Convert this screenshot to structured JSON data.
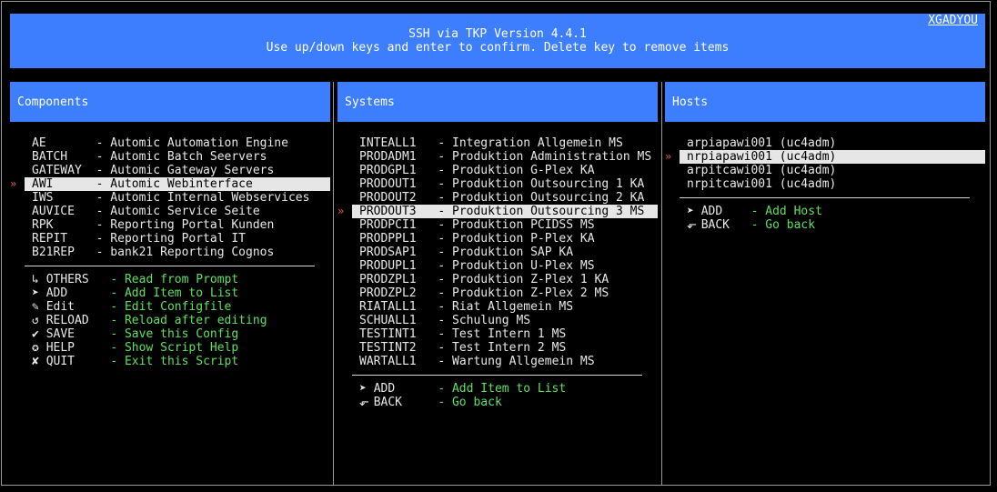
{
  "header": {
    "title": "SSH via TKP Version 4.4.1",
    "hint": "Use up/down keys and enter to confirm. Delete key to remove items",
    "user": "XGADYOU"
  },
  "components": {
    "title": "Components",
    "items": [
      {
        "key": "AE",
        "desc": "Automic Automation Engine"
      },
      {
        "key": "BATCH",
        "desc": "Automic Batch Seervers"
      },
      {
        "key": "GATEWAY",
        "desc": "Automic Gateway Servers"
      },
      {
        "key": "AWI",
        "desc": "Automic Webinterface"
      },
      {
        "key": "IWS",
        "desc": "Automic Internal Webservices"
      },
      {
        "key": "AUVICE",
        "desc": "Automic Service Seite"
      },
      {
        "key": "RPK",
        "desc": "Reporting Portal Kunden"
      },
      {
        "key": "REPIT",
        "desc": "Reporting Portal IT"
      },
      {
        "key": "B21REP",
        "desc": "bank21 Reporting Cognos"
      }
    ],
    "selected_index": 3,
    "actions": [
      {
        "icon": "↳",
        "key": "OTHERS",
        "desc": "Read from Prompt"
      },
      {
        "icon": "➤",
        "key": "ADD",
        "desc": "Add Item to List"
      },
      {
        "icon": "✎",
        "key": "Edit",
        "desc": "Edit Configfile"
      },
      {
        "icon": "↺",
        "key": "RELOAD",
        "desc": "Reload after editing"
      },
      {
        "icon": "✔",
        "key": "SAVE",
        "desc": "Save this Config"
      },
      {
        "icon": "✪",
        "key": "HELP",
        "desc": "Show Script Help"
      },
      {
        "icon": "✘",
        "key": "QUIT",
        "desc": "Exit this Script"
      }
    ]
  },
  "systems": {
    "title": "Systems",
    "items": [
      {
        "key": "INTEALL1",
        "desc": "Integration Allgemein MS"
      },
      {
        "key": "PRODADM1",
        "desc": "Produktion Administration MS"
      },
      {
        "key": "PRODGPL1",
        "desc": "Produktion G-Plex KA"
      },
      {
        "key": "PRODOUT1",
        "desc": "Produktion Outsourcing 1 KA"
      },
      {
        "key": "PRODOUT2",
        "desc": "Produktion Outsourcing 2 KA"
      },
      {
        "key": "PRODOUT3",
        "desc": "Produktion Outsourcing 3 MS"
      },
      {
        "key": "PRODPCI1",
        "desc": "Produktion PCIDSS MS"
      },
      {
        "key": "PRODPPL1",
        "desc": "Produktion P-Plex KA"
      },
      {
        "key": "PRODSAP1",
        "desc": "Produktion SAP KA"
      },
      {
        "key": "PRODUPL1",
        "desc": "Produktion U-Plex MS"
      },
      {
        "key": "PRODZPL1",
        "desc": "Produktion Z-Plex 1 KA"
      },
      {
        "key": "PRODZPL2",
        "desc": "Produktion Z-Plex 2 MS"
      },
      {
        "key": "RIATALL1",
        "desc": "Riat Allgemein MS"
      },
      {
        "key": "SCHUALL1",
        "desc": "Schulung MS"
      },
      {
        "key": "TESTINT1",
        "desc": "Test Intern 1 MS"
      },
      {
        "key": "TESTINT2",
        "desc": "Test Intern 2 MS"
      },
      {
        "key": "WARTALL1",
        "desc": "Wartung Allgemein MS"
      }
    ],
    "selected_index": 5,
    "actions": [
      {
        "icon": "➤",
        "key": "ADD",
        "desc": "Add Item to List"
      },
      {
        "icon": "⬐",
        "key": "BACK",
        "desc": "Go back"
      }
    ]
  },
  "hosts": {
    "title": "Hosts",
    "items": [
      "arpiapawi001 (uc4adm)",
      "nrpiapawi001 (uc4adm)",
      "arpitcawi001 (uc4adm)",
      "nrpitcawi001 (uc4adm)"
    ],
    "selected_index": 1,
    "actions": [
      {
        "icon": "➤",
        "key": "ADD",
        "desc": "Add Host"
      },
      {
        "icon": "⬐",
        "key": "BACK",
        "desc": "Go back"
      }
    ]
  },
  "pointer": "»",
  "separator": "-",
  "colors": {
    "header_bg": "#3d7eff",
    "action_text": "#5fe05f",
    "pointer": "#e05a50",
    "selection_bg": "#e6e6e6"
  }
}
